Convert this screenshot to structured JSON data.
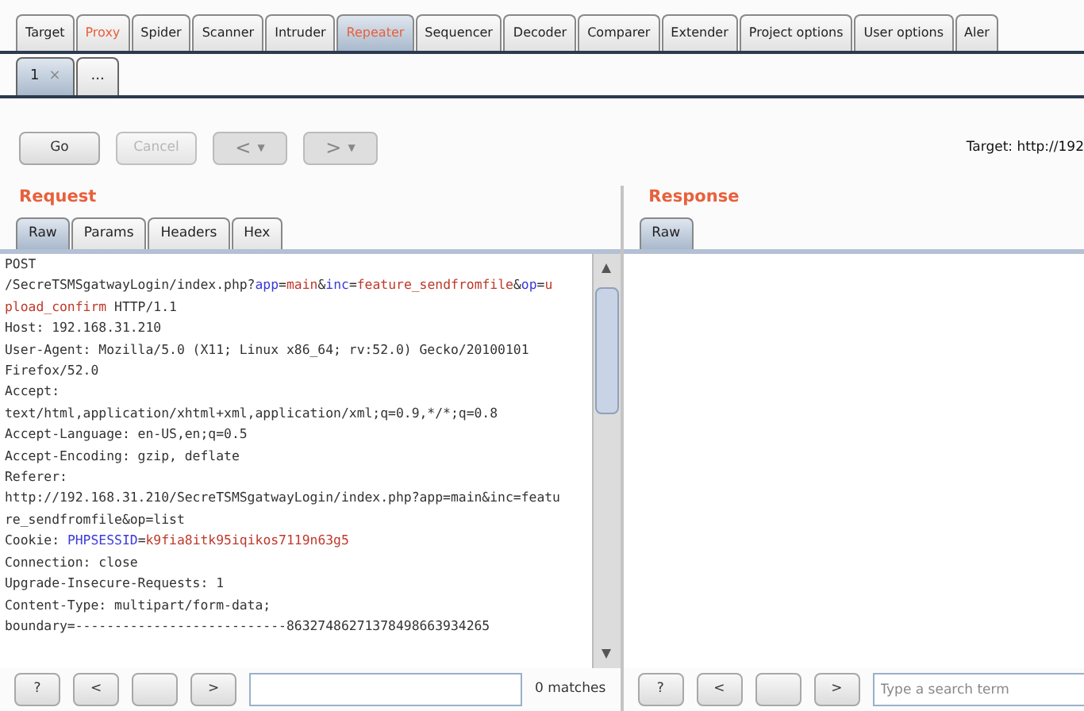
{
  "main_tabs": [
    {
      "label": "Target",
      "selected": false,
      "highlighted": false
    },
    {
      "label": "Proxy",
      "selected": false,
      "highlighted": true
    },
    {
      "label": "Spider",
      "selected": false,
      "highlighted": false
    },
    {
      "label": "Scanner",
      "selected": false,
      "highlighted": false
    },
    {
      "label": "Intruder",
      "selected": false,
      "highlighted": false
    },
    {
      "label": "Repeater",
      "selected": true,
      "highlighted": true
    },
    {
      "label": "Sequencer",
      "selected": false,
      "highlighted": false
    },
    {
      "label": "Decoder",
      "selected": false,
      "highlighted": false
    },
    {
      "label": "Comparer",
      "selected": false,
      "highlighted": false
    },
    {
      "label": "Extender",
      "selected": false,
      "highlighted": false
    },
    {
      "label": "Project options",
      "selected": false,
      "highlighted": false
    },
    {
      "label": "User options",
      "selected": false,
      "highlighted": false
    },
    {
      "label": "Aler",
      "selected": false,
      "highlighted": false
    }
  ],
  "repeater_tabs": [
    {
      "label": "1",
      "close": "×",
      "selected": true
    },
    {
      "label": "...",
      "selected": false
    }
  ],
  "toolbar": {
    "go": "Go",
    "cancel": "Cancel",
    "back": "<",
    "forward": ">",
    "caret": "▼",
    "target": "Target: http://192"
  },
  "request": {
    "title": "Request",
    "tabs": [
      {
        "label": "Raw",
        "selected": true
      },
      {
        "label": "Params",
        "selected": false
      },
      {
        "label": "Headers",
        "selected": false
      },
      {
        "label": "Hex",
        "selected": false
      }
    ],
    "lines": [
      [
        {
          "text": "POST",
          "kind": "plain"
        }
      ],
      [
        {
          "text": "/SecreTSMSgatwayLogin/index.php?",
          "kind": "plain"
        },
        {
          "text": "app",
          "kind": "name"
        },
        {
          "text": "=",
          "kind": "plain"
        },
        {
          "text": "main",
          "kind": "value"
        },
        {
          "text": "&",
          "kind": "plain"
        },
        {
          "text": "inc",
          "kind": "name"
        },
        {
          "text": "=",
          "kind": "plain"
        },
        {
          "text": "feature_sendfromfile",
          "kind": "value"
        },
        {
          "text": "&",
          "kind": "plain"
        },
        {
          "text": "op",
          "kind": "name"
        },
        {
          "text": "=",
          "kind": "plain"
        },
        {
          "text": "u",
          "kind": "value"
        }
      ],
      [
        {
          "text": "pload_confirm",
          "kind": "value"
        },
        {
          "text": " HTTP/1.1",
          "kind": "plain"
        }
      ],
      [
        {
          "text": "Host: 192.168.31.210",
          "kind": "plain"
        }
      ],
      [
        {
          "text": "User-Agent: Mozilla/5.0 (X11; Linux x86_64; rv:52.0) Gecko/20100101",
          "kind": "plain"
        }
      ],
      [
        {
          "text": "Firefox/52.0",
          "kind": "plain"
        }
      ],
      [
        {
          "text": "Accept:",
          "kind": "plain"
        }
      ],
      [
        {
          "text": "text/html,application/xhtml+xml,application/xml;q=0.9,*/*;q=0.8",
          "kind": "plain"
        }
      ],
      [
        {
          "text": "Accept-Language: en-US,en;q=0.5",
          "kind": "plain"
        }
      ],
      [
        {
          "text": "Accept-Encoding: gzip, deflate",
          "kind": "plain"
        }
      ],
      [
        {
          "text": "Referer:",
          "kind": "plain"
        }
      ],
      [
        {
          "text": "http://192.168.31.210/SecreTSMSgatwayLogin/index.php?app=main&inc=featu",
          "kind": "plain"
        }
      ],
      [
        {
          "text": "re_sendfromfile&op=list",
          "kind": "plain"
        }
      ],
      [
        {
          "text": "Cookie: ",
          "kind": "plain"
        },
        {
          "text": "PHPSESSID",
          "kind": "name"
        },
        {
          "text": "=",
          "kind": "plain"
        },
        {
          "text": "k9fia8itk95iqikos7119n63g5",
          "kind": "value"
        }
      ],
      [
        {
          "text": "Connection: close",
          "kind": "plain"
        }
      ],
      [
        {
          "text": "Upgrade-Insecure-Requests: 1",
          "kind": "plain"
        }
      ],
      [
        {
          "text": "Content-Type: multipart/form-data;",
          "kind": "plain"
        }
      ],
      [
        {
          "text": "boundary=---------------------------86327486271378498663934265",
          "kind": "plain"
        }
      ]
    ],
    "search": {
      "help": "?",
      "prev": "<",
      "next": ">",
      "matches": "0 matches"
    }
  },
  "response": {
    "title": "Response",
    "tabs": [
      {
        "label": "Raw",
        "selected": true
      }
    ],
    "search": {
      "help": "?",
      "prev": "<",
      "next": ">",
      "placeholder": "Type a search term"
    }
  }
}
